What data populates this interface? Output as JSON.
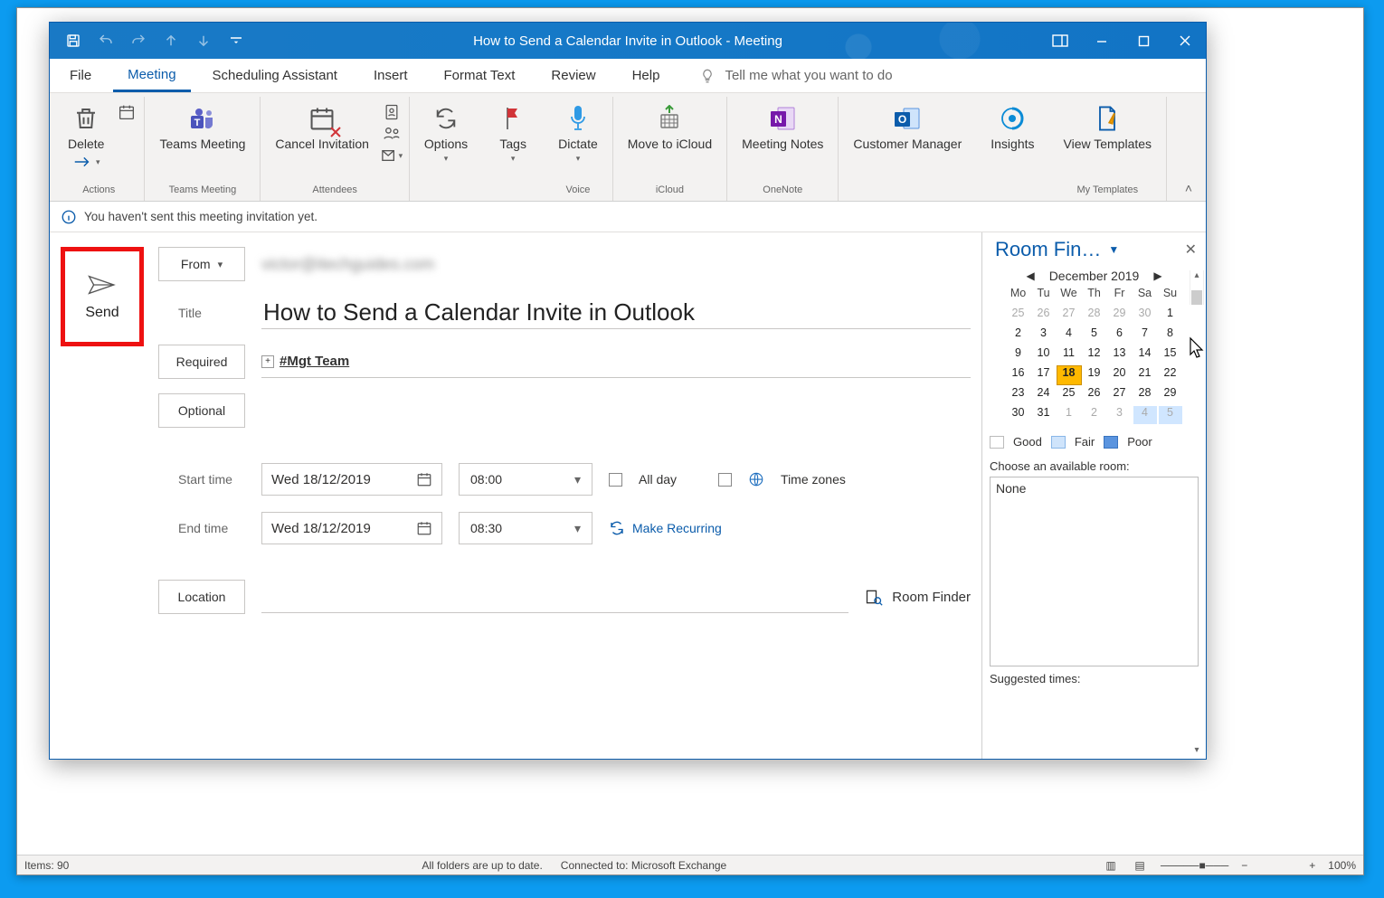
{
  "bg": {
    "items": "Items: 90",
    "foldersync": "All folders are up to date.",
    "conn": "Connected to: Microsoft Exchange",
    "zoom": "100%"
  },
  "titlebar": {
    "title": "How to Send a Calendar Invite in Outlook  -  Meeting"
  },
  "tabs": {
    "file": "File",
    "meeting": "Meeting",
    "scheduling": "Scheduling Assistant",
    "insert": "Insert",
    "format": "Format Text",
    "review": "Review",
    "help": "Help",
    "tellme": "Tell me what you want to do"
  },
  "ribbon": {
    "delete": "Delete",
    "teams": "Teams Meeting",
    "cancel": "Cancel Invitation",
    "options": "Options",
    "tags": "Tags",
    "dictate": "Dictate",
    "icloud": "Move to iCloud",
    "notes": "Meeting Notes",
    "custmgr": "Customer Manager",
    "insights": "Insights",
    "templates": "View Templates",
    "grp_actions": "Actions",
    "grp_teams": "Teams Meeting",
    "grp_attendees": "Attendees",
    "grp_voice": "Voice",
    "grp_icloud": "iCloud",
    "grp_onenote": "OneNote",
    "grp_templates": "My Templates"
  },
  "infobar": {
    "msg": "You haven't sent this meeting invitation yet."
  },
  "form": {
    "send": "Send",
    "from": "From",
    "from_value": "victor@itechguides.com",
    "title_lbl": "Title",
    "title_val": "How to Send a Calendar Invite in Outlook",
    "required": "Required",
    "required_val": "#Mgt Team",
    "optional": "Optional",
    "start": "Start time",
    "start_date": "Wed 18/12/2019",
    "start_time": "08:00",
    "end": "End time",
    "end_date": "Wed 18/12/2019",
    "end_time": "08:30",
    "allday": "All day",
    "tz": "Time zones",
    "recurring": "Make Recurring",
    "location": "Location",
    "roomfinder": "Room Finder"
  },
  "side": {
    "title": "Room Fin…",
    "month": "December 2019",
    "dow": [
      "Mo",
      "Tu",
      "We",
      "Th",
      "Fr",
      "Sa",
      "Su"
    ],
    "weeks": [
      [
        {
          "d": 25,
          "c": "dim"
        },
        {
          "d": 26,
          "c": "dim"
        },
        {
          "d": 27,
          "c": "dim"
        },
        {
          "d": 28,
          "c": "dim"
        },
        {
          "d": 29,
          "c": "dim"
        },
        {
          "d": 30,
          "c": "dim"
        },
        {
          "d": 1,
          "c": ""
        }
      ],
      [
        {
          "d": 2,
          "c": ""
        },
        {
          "d": 3,
          "c": ""
        },
        {
          "d": 4,
          "c": ""
        },
        {
          "d": 5,
          "c": ""
        },
        {
          "d": 6,
          "c": ""
        },
        {
          "d": 7,
          "c": ""
        },
        {
          "d": 8,
          "c": ""
        }
      ],
      [
        {
          "d": 9,
          "c": ""
        },
        {
          "d": 10,
          "c": ""
        },
        {
          "d": 11,
          "c": ""
        },
        {
          "d": 12,
          "c": ""
        },
        {
          "d": 13,
          "c": ""
        },
        {
          "d": 14,
          "c": ""
        },
        {
          "d": 15,
          "c": ""
        }
      ],
      [
        {
          "d": 16,
          "c": ""
        },
        {
          "d": 17,
          "c": ""
        },
        {
          "d": 18,
          "c": "hl"
        },
        {
          "d": 19,
          "c": ""
        },
        {
          "d": 20,
          "c": ""
        },
        {
          "d": 21,
          "c": ""
        },
        {
          "d": 22,
          "c": ""
        }
      ],
      [
        {
          "d": 23,
          "c": ""
        },
        {
          "d": 24,
          "c": ""
        },
        {
          "d": 25,
          "c": ""
        },
        {
          "d": 26,
          "c": ""
        },
        {
          "d": 27,
          "c": ""
        },
        {
          "d": 28,
          "c": ""
        },
        {
          "d": 29,
          "c": ""
        }
      ],
      [
        {
          "d": 30,
          "c": ""
        },
        {
          "d": 31,
          "c": ""
        },
        {
          "d": 1,
          "c": "dim"
        },
        {
          "d": 2,
          "c": "dim"
        },
        {
          "d": 3,
          "c": "dim"
        },
        {
          "d": 4,
          "c": "dim fair"
        },
        {
          "d": 5,
          "c": "dim fair"
        }
      ]
    ],
    "legend_good": "Good",
    "legend_fair": "Fair",
    "legend_poor": "Poor",
    "choose_lbl": "Choose an available room:",
    "room_none": "None",
    "suggested": "Suggested times:"
  }
}
